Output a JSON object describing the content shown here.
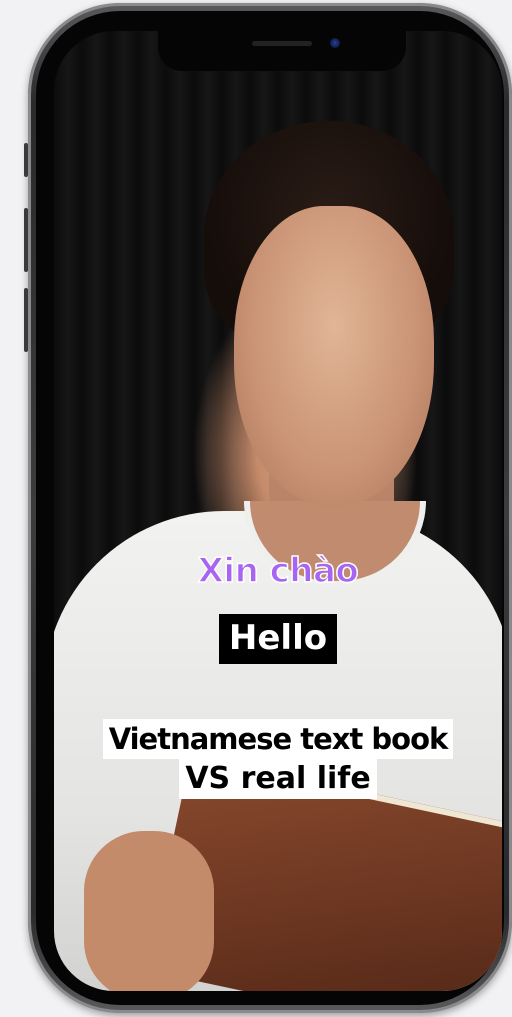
{
  "video": {
    "caption_vietnamese": "Xin chào",
    "caption_english": "Hello",
    "title_line_1": "Vietnamese text book",
    "title_line_2": "VS real life"
  },
  "colors": {
    "vietnamese_caption": "#a865f2",
    "english_caption_bg": "#000000",
    "title_bg": "#ffffff"
  }
}
